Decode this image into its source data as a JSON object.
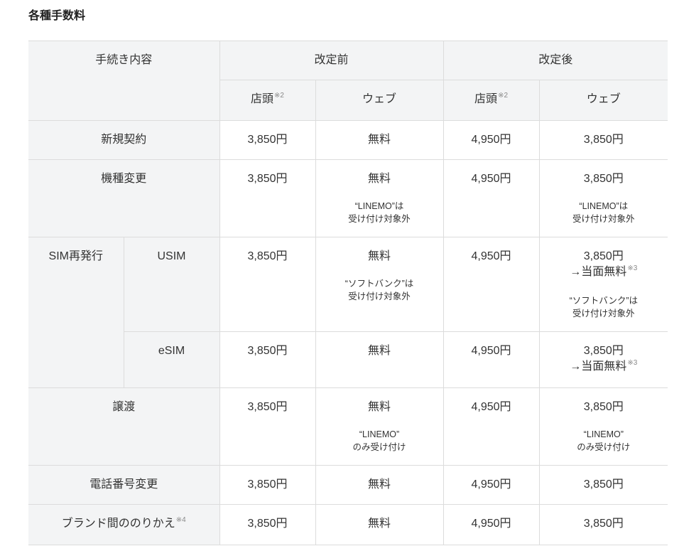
{
  "title": "各種手数料",
  "colors": {
    "header_bg": "#f3f4f5",
    "border": "#dcdcdc",
    "text": "#333333"
  },
  "table": {
    "header": {
      "procedure": "手続き内容",
      "before": "改定前",
      "after": "改定後",
      "store": "店頭",
      "store_note": "※2",
      "web": "ウェブ"
    },
    "rows": [
      {
        "label": "新規契約",
        "before_store": "3,850円",
        "before_web": "無料",
        "after_store": "4,950円",
        "after_web": "3,850円"
      },
      {
        "label": "機種変更",
        "before_store": "3,850円",
        "before_web": "無料",
        "before_web_note": [
          "“LINEMO”は",
          "受け付け対象外"
        ],
        "after_store": "4,950円",
        "after_web": "3,850円",
        "after_web_note": [
          "“LINEMO”は",
          "受け付け対象外"
        ]
      },
      {
        "group": "SIM再発行",
        "label": "USIM",
        "before_store": "3,850円",
        "before_web": "無料",
        "before_web_note": [
          "“ソフトバンク”は",
          "受け付け対象外"
        ],
        "after_store": "4,950円",
        "after_web": "3,850円",
        "after_web_change": "→当面無料",
        "after_web_change_note": "※3",
        "after_web_note": [
          "“ソフトバンク”は",
          "受け付け対象外"
        ]
      },
      {
        "label": "eSIM",
        "before_store": "3,850円",
        "before_web": "無料",
        "after_store": "4,950円",
        "after_web": "3,850円",
        "after_web_change": "→当面無料",
        "after_web_change_note": "※3"
      },
      {
        "label": "譲渡",
        "before_store": "3,850円",
        "before_web": "無料",
        "before_web_note": [
          "“LINEMO”",
          "のみ受け付け"
        ],
        "after_store": "4,950円",
        "after_web": "3,850円",
        "after_web_note": [
          "“LINEMO”",
          "のみ受け付け"
        ]
      },
      {
        "label": "電話番号変更",
        "before_store": "3,850円",
        "before_web": "無料",
        "after_store": "4,950円",
        "after_web": "3,850円"
      },
      {
        "label": "ブランド間ののりかえ",
        "label_note": "※4",
        "before_store": "3,850円",
        "before_web": "無料",
        "after_store": "4,950円",
        "after_web": "3,850円"
      }
    ]
  }
}
